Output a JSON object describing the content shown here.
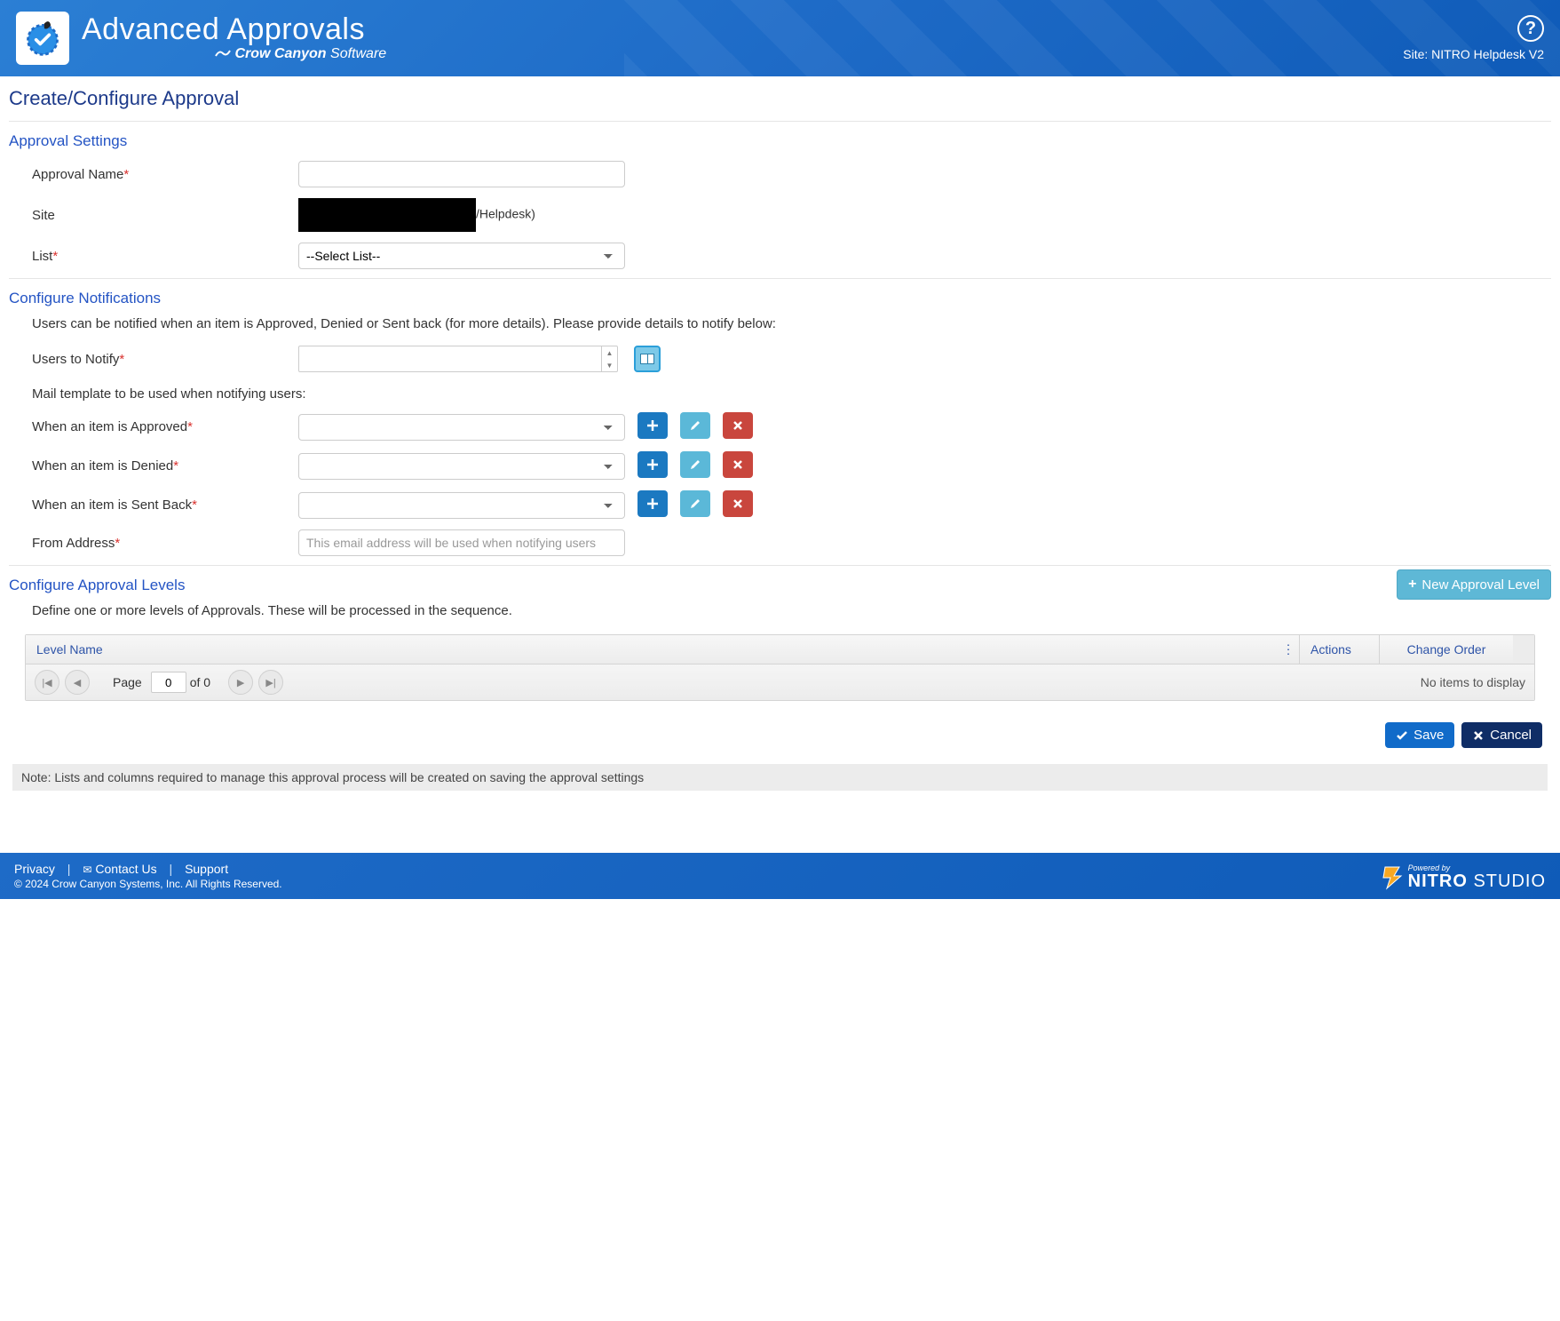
{
  "header": {
    "app_title": "Advanced Approvals",
    "vendor": "Crow Canyon",
    "vendor_suffix": "Software",
    "site_prefix": "Site:",
    "site_name": "NITRO Helpdesk V2"
  },
  "page": {
    "title": "Create/Configure Approval"
  },
  "approval_settings": {
    "section_title": "Approval Settings",
    "approval_name_label": "Approval Name",
    "approval_name_value": "",
    "site_label": "Site",
    "site_suffix": "/Helpdesk)",
    "list_label": "List",
    "list_placeholder": "--Select List--"
  },
  "notifications": {
    "section_title": "Configure Notifications",
    "description": "Users can be notified when an item is Approved, Denied or Sent back (for more details). Please provide details to notify below:",
    "users_label": "Users to Notify",
    "mail_template_heading": "Mail template to be used when notifying users:",
    "approved_label": "When an item is Approved",
    "denied_label": "When an item is Denied",
    "sentback_label": "When an item is Sent Back",
    "from_label": "From Address",
    "from_placeholder": "This email address will be used when notifying users"
  },
  "levels": {
    "section_title": "Configure Approval Levels",
    "new_button": "New Approval Level",
    "description": "Define one or more levels of Approvals. These will be processed in the sequence.",
    "columns": {
      "level_name": "Level Name",
      "actions": "Actions",
      "change_order": "Change Order"
    },
    "pager": {
      "page_label": "Page",
      "page_value": "0",
      "of_label": "of 0",
      "empty": "No items to display"
    }
  },
  "actions": {
    "save": "Save",
    "cancel": "Cancel"
  },
  "note": "Note: Lists and columns required to manage this approval process will be created on saving the approval settings",
  "footer": {
    "privacy": "Privacy",
    "contact": "Contact Us",
    "support": "Support",
    "copyright": "© 2024 Crow Canyon Systems, Inc. All Rights Reserved.",
    "powered_by": "Powered by",
    "brand_a": "NITRO",
    "brand_b": "STUDIO"
  }
}
